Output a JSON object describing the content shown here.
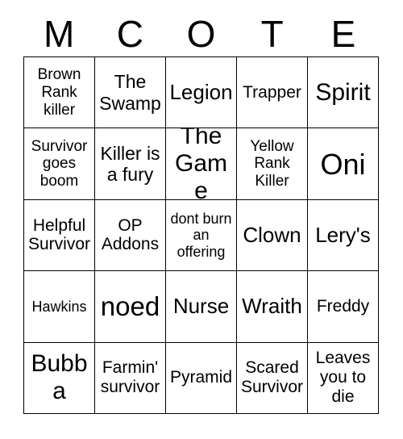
{
  "card": {
    "header_letters": [
      "M",
      "C",
      "O",
      "T",
      "E"
    ],
    "grid_size": 5,
    "colors": {
      "background": "#ffffff",
      "text": "#000000",
      "grid_line": "#000000"
    },
    "rows": [
      [
        {
          "label": "Brown Rank killer",
          "size": "s"
        },
        {
          "label": "The Swamp",
          "size": "l"
        },
        {
          "label": "Legion",
          "size": "xl"
        },
        {
          "label": "Trapper",
          "size": "m"
        },
        {
          "label": "Spirit",
          "size": "xxl"
        }
      ],
      [
        {
          "label": "Survivor goes boom",
          "size": "s"
        },
        {
          "label": "Killer is a fury",
          "size": "l"
        },
        {
          "label": "The Game",
          "size": "xxl"
        },
        {
          "label": "Yellow Rank Killer",
          "size": "s"
        },
        {
          "label": "Oni",
          "size": "4xl"
        }
      ],
      [
        {
          "label": "Helpful Survivor",
          "size": "m"
        },
        {
          "label": "OP Addons",
          "size": "m"
        },
        {
          "label": "dont burn an offering",
          "size": "xs"
        },
        {
          "label": "Clown",
          "size": "xl"
        },
        {
          "label": "Lery's",
          "size": "xl"
        }
      ],
      [
        {
          "label": "Hawkins",
          "size": "xs"
        },
        {
          "label": "noed",
          "size": "3xl"
        },
        {
          "label": "Nurse",
          "size": "xl"
        },
        {
          "label": "Wraith",
          "size": "xl"
        },
        {
          "label": "Freddy",
          "size": "m"
        }
      ],
      [
        {
          "label": "Bubba",
          "size": "xxl"
        },
        {
          "label": "Farmin' survivor",
          "size": "m"
        },
        {
          "label": "Pyramid",
          "size": "m"
        },
        {
          "label": "Scared Survivor",
          "size": "m"
        },
        {
          "label": "Leaves you to die",
          "size": "m"
        }
      ]
    ]
  }
}
